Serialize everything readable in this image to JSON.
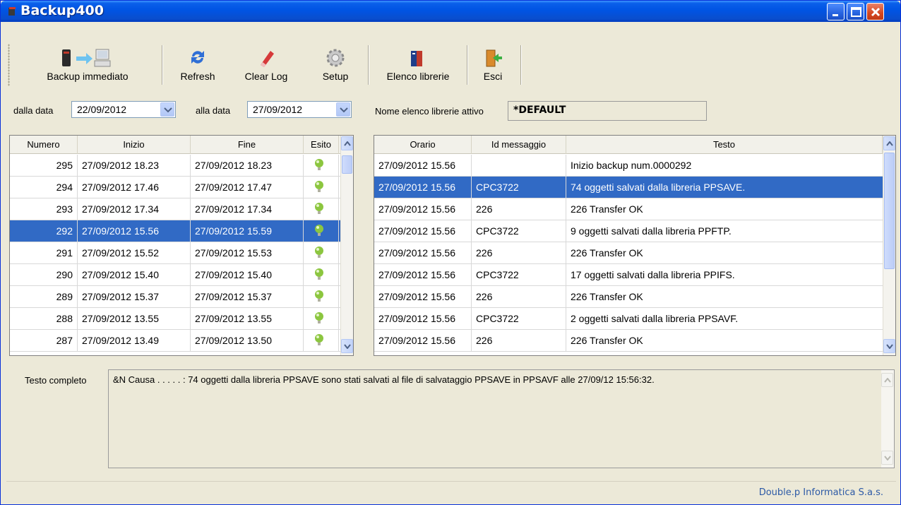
{
  "window": {
    "title": "Backup400"
  },
  "toolbar": {
    "backup_label": "Backup immediato",
    "refresh_label": "Refresh",
    "clearlog_label": "Clear Log",
    "setup_label": "Setup",
    "elenco_label": "Elenco librerie",
    "esci_label": "Esci"
  },
  "filters": {
    "from_label": "dalla data",
    "from_value": "22/09/2012",
    "to_label": "alla data",
    "to_value": "27/09/2012",
    "nome_label": "Nome elenco librerie attivo",
    "nome_value": "*DEFAULT"
  },
  "backups": {
    "columns": [
      "Numero",
      "Inizio",
      "Fine",
      "Esito"
    ],
    "rows": [
      {
        "numero": "295",
        "inizio": "27/09/2012 18.23",
        "fine": "27/09/2012 18.23"
      },
      {
        "numero": "294",
        "inizio": "27/09/2012 17.46",
        "fine": "27/09/2012 17.47"
      },
      {
        "numero": "293",
        "inizio": "27/09/2012 17.34",
        "fine": "27/09/2012 17.34"
      },
      {
        "numero": "292",
        "inizio": "27/09/2012 15.56",
        "fine": "27/09/2012 15.59"
      },
      {
        "numero": "291",
        "inizio": "27/09/2012 15.52",
        "fine": "27/09/2012 15.53"
      },
      {
        "numero": "290",
        "inizio": "27/09/2012 15.40",
        "fine": "27/09/2012 15.40"
      },
      {
        "numero": "289",
        "inizio": "27/09/2012 15.37",
        "fine": "27/09/2012 15.37"
      },
      {
        "numero": "288",
        "inizio": "27/09/2012 13.55",
        "fine": "27/09/2012 13.55"
      },
      {
        "numero": "287",
        "inizio": "27/09/2012 13.49",
        "fine": "27/09/2012 13.50"
      }
    ]
  },
  "messages": {
    "columns": [
      "Orario",
      "Id messaggio",
      "Testo"
    ],
    "rows": [
      {
        "orario": "27/09/2012 15.56",
        "id": "",
        "testo": "Inizio backup num.0000292"
      },
      {
        "orario": "27/09/2012 15.56",
        "id": "CPC3722",
        "testo": "74 oggetti salvati dalla libreria PPSAVE."
      },
      {
        "orario": "27/09/2012 15.56",
        "id": "226",
        "testo": "226 Transfer OK"
      },
      {
        "orario": "27/09/2012 15.56",
        "id": "CPC3722",
        "testo": "9 oggetti salvati dalla libreria PPFTP."
      },
      {
        "orario": "27/09/2012 15.56",
        "id": "226",
        "testo": "226 Transfer OK"
      },
      {
        "orario": "27/09/2012 15.56",
        "id": "CPC3722",
        "testo": "17 oggetti salvati dalla libreria PPIFS."
      },
      {
        "orario": "27/09/2012 15.56",
        "id": "226",
        "testo": "226 Transfer OK"
      },
      {
        "orario": "27/09/2012 15.56",
        "id": "CPC3722",
        "testo": "2 oggetti salvati dalla libreria PPSAVF."
      },
      {
        "orario": "27/09/2012 15.56",
        "id": "226",
        "testo": "226 Transfer OK"
      }
    ]
  },
  "detail": {
    "label": "Testo completo",
    "text": "&N Causa . . . . . :   74 oggetti dalla libreria PPSAVE sono stati salvati al file di salvataggio PPSAVE in PPSAVF alle 27/09/12 15:56:32."
  },
  "status": {
    "company": "Double.p Informatica S.a.s."
  },
  "colors": {
    "selection": "#316ac5",
    "titlebar": "#0054e3",
    "esito_ok": "#8cc63f"
  }
}
